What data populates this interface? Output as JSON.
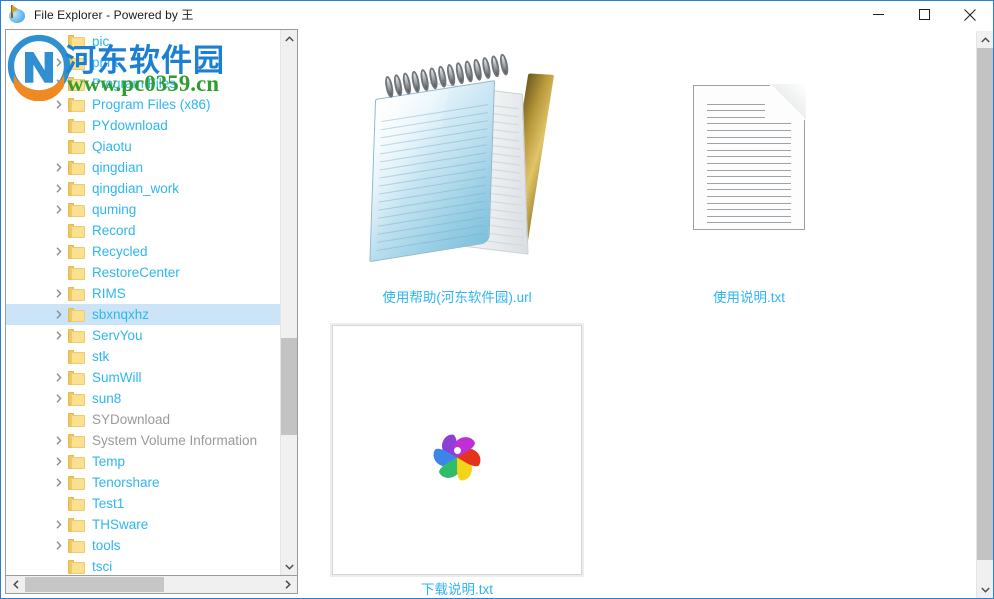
{
  "window": {
    "title": "File Explorer - Powered by 王",
    "app_icon": "app-globe-flag-icon",
    "accent_border": "#2a7fd4",
    "controls": {
      "minimize": "minimize-icon",
      "maximize": "maximize-icon",
      "close": "close-icon"
    }
  },
  "watermark": {
    "site_name": "河东软件园",
    "site_url": "www.pc0359.cn",
    "site_name_color": "#1b7fd4",
    "site_url_color": "#2f9e2f"
  },
  "tree": {
    "label_color": "#2eb6f0",
    "system_label_color": "#9a9a9a",
    "selection_color": "#cce4f7",
    "scrollbar": {
      "up_arrow": "chevron-up-icon",
      "down_arrow": "chevron-down-icon",
      "left_arrow": "chevron-left-icon",
      "right_arrow": "chevron-right-icon"
    },
    "items": [
      {
        "label": "pic",
        "expandable": false,
        "selected": false,
        "system": false
      },
      {
        "label": "print",
        "expandable": true,
        "selected": false,
        "system": false
      },
      {
        "label": "Program Files",
        "expandable": true,
        "selected": false,
        "system": false
      },
      {
        "label": "Program Files (x86)",
        "expandable": true,
        "selected": false,
        "system": false
      },
      {
        "label": "PYdownload",
        "expandable": false,
        "selected": false,
        "system": false
      },
      {
        "label": "Qiaotu",
        "expandable": false,
        "selected": false,
        "system": false
      },
      {
        "label": "qingdian",
        "expandable": true,
        "selected": false,
        "system": false
      },
      {
        "label": "qingdian_work",
        "expandable": true,
        "selected": false,
        "system": false
      },
      {
        "label": "quming",
        "expandable": true,
        "selected": false,
        "system": false
      },
      {
        "label": "Record",
        "expandable": false,
        "selected": false,
        "system": false
      },
      {
        "label": "Recycled",
        "expandable": true,
        "selected": false,
        "system": false
      },
      {
        "label": "RestoreCenter",
        "expandable": false,
        "selected": false,
        "system": false
      },
      {
        "label": "RIMS",
        "expandable": true,
        "selected": false,
        "system": false
      },
      {
        "label": "sbxnqxhz",
        "expandable": true,
        "selected": true,
        "system": false
      },
      {
        "label": "ServYou",
        "expandable": true,
        "selected": false,
        "system": false
      },
      {
        "label": "stk",
        "expandable": false,
        "selected": false,
        "system": false
      },
      {
        "label": "SumWill",
        "expandable": true,
        "selected": false,
        "system": false
      },
      {
        "label": "sun8",
        "expandable": true,
        "selected": false,
        "system": false
      },
      {
        "label": "SYDownload",
        "expandable": false,
        "selected": false,
        "system": true
      },
      {
        "label": "System Volume Information",
        "expandable": true,
        "selected": false,
        "system": true
      },
      {
        "label": "Temp",
        "expandable": true,
        "selected": false,
        "system": false
      },
      {
        "label": "Tenorshare",
        "expandable": true,
        "selected": false,
        "system": false
      },
      {
        "label": "Test1",
        "expandable": false,
        "selected": false,
        "system": false
      },
      {
        "label": "THSware",
        "expandable": true,
        "selected": false,
        "system": false
      },
      {
        "label": "tools",
        "expandable": true,
        "selected": false,
        "system": false
      },
      {
        "label": "tsci",
        "expandable": false,
        "selected": false,
        "system": false
      }
    ]
  },
  "content": {
    "caption_color": "#2eb6f0",
    "files": [
      {
        "name": "使用帮助(河东软件园).url",
        "icon": "notepad-icon",
        "kind": "notepad"
      },
      {
        "name": "使用说明.txt",
        "icon": "text-document-icon",
        "kind": "txt"
      },
      {
        "name": "下载说明.txt",
        "icon": "pinwheel-icon",
        "kind": "thumb"
      }
    ]
  }
}
